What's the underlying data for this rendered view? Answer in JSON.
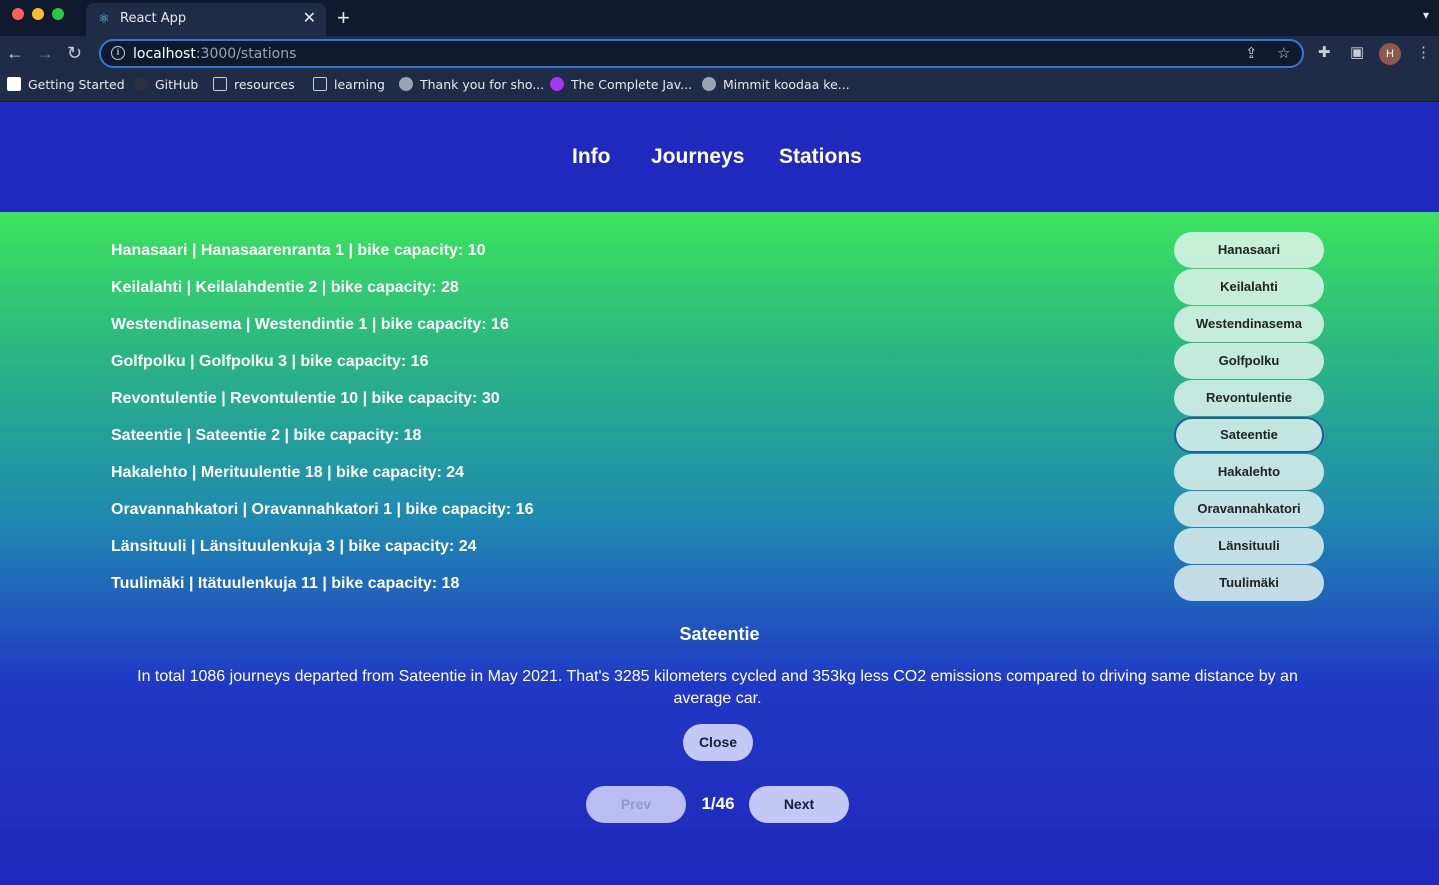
{
  "browser": {
    "tab_title": "React App",
    "url_host": "localhost",
    "url_path": ":3000/stations",
    "avatar_initial": "H",
    "bookmarks": [
      {
        "label": "Getting Started",
        "icon": "notion-icon"
      },
      {
        "label": "GitHub",
        "icon": "github-icon"
      },
      {
        "label": "resources",
        "icon": "folder-icon"
      },
      {
        "label": "learning",
        "icon": "folder-icon"
      },
      {
        "label": "Thank you for sho...",
        "icon": "globe-icon"
      },
      {
        "label": "The Complete Jav...",
        "icon": "udemy-icon"
      },
      {
        "label": "Mimmit koodaa ke...",
        "icon": "globe-icon"
      }
    ]
  },
  "nav": {
    "info": "Info",
    "journeys": "Journeys",
    "stations": "Stations"
  },
  "stations": [
    {
      "line": "Hanasaari | Hanasaarenranta 1 | bike capacity: 10",
      "button": "Hanasaari"
    },
    {
      "line": "Keilalahti | Keilalahdentie 2 | bike capacity: 28",
      "button": "Keilalahti"
    },
    {
      "line": "Westendinasema | Westendintie 1 | bike capacity: 16",
      "button": "Westendinasema"
    },
    {
      "line": "Golfpolku | Golfpolku 3 | bike capacity: 16",
      "button": "Golfpolku"
    },
    {
      "line": "Revontulentie | Revontulentie 10 | bike capacity: 30",
      "button": "Revontulentie"
    },
    {
      "line": "Sateentie | Sateentie 2 | bike capacity: 18",
      "button": "Sateentie"
    },
    {
      "line": "Hakalehto | Merituulentie 18 | bike capacity: 24",
      "button": "Hakalehto"
    },
    {
      "line": "Oravannahkatori | Oravannahkatori 1 | bike capacity: 16",
      "button": "Oravannahkatori"
    },
    {
      "line": "Länsituuli | Länsituulenkuja 3 | bike capacity: 24",
      "button": "Länsituuli"
    },
    {
      "line": "Tuulimäki | Itätuulenkuja 11 | bike capacity: 18",
      "button": "Tuulimäki"
    }
  ],
  "selected_station": "Sateentie",
  "detail": {
    "title": "Sateentie",
    "text": "In total 1086 journeys departed from Sateentie in May 2021. That's 3285 kilometers cycled and 353kg less CO2 emissions compared to driving same distance by an average car.",
    "close_label": "Close"
  },
  "pagination": {
    "prev_label": "Prev",
    "next_label": "Next",
    "page_text": "1/46"
  },
  "colors": {
    "header_bg": "#2128bd",
    "gradient_top": "#3de35e",
    "gradient_bottom": "#2128bd",
    "button_bg": "#c4c8f5"
  }
}
